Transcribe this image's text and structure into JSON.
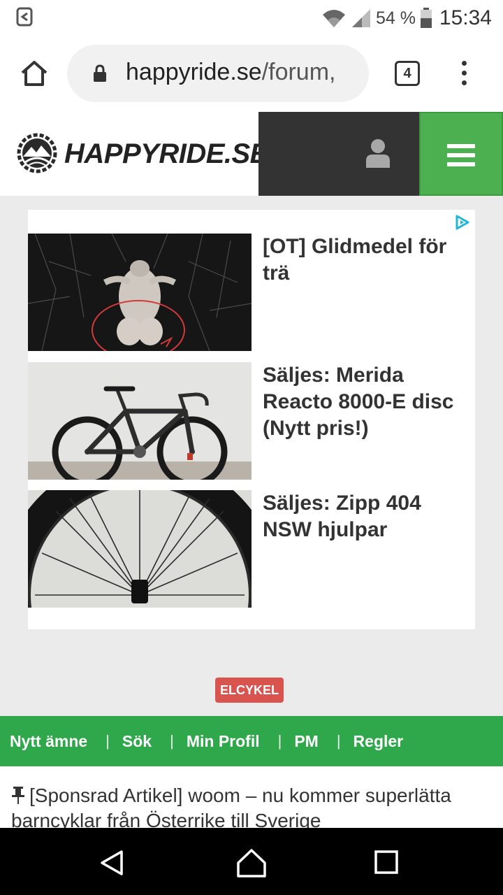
{
  "status_bar": {
    "battery_percent": "54 %",
    "time": "15:34"
  },
  "browser": {
    "url_domain": "happyride.se",
    "url_path": "/forum,",
    "tab_count": "4"
  },
  "site": {
    "logo_text": "HAPPYRIDE.SE",
    "accent_color": "#4cb050"
  },
  "ads": [
    {
      "title": "[OT] Glidmedel för trä"
    },
    {
      "title": "Säljes: Merida Reacto 8000-E disc (Nytt pris!)"
    },
    {
      "title": "Säljes: Zipp 404 NSW hjulpar"
    }
  ],
  "tag": "ELCYKEL",
  "forum_nav": {
    "items": [
      "Nytt ämne",
      "Sök",
      "Min Profil",
      "PM",
      "Regler"
    ],
    "separator": "|"
  },
  "sticky_topic": {
    "title": "[Sponsrad Artikel] woom – nu kommer superlätta barncyklar från Österrike till Sverige"
  }
}
